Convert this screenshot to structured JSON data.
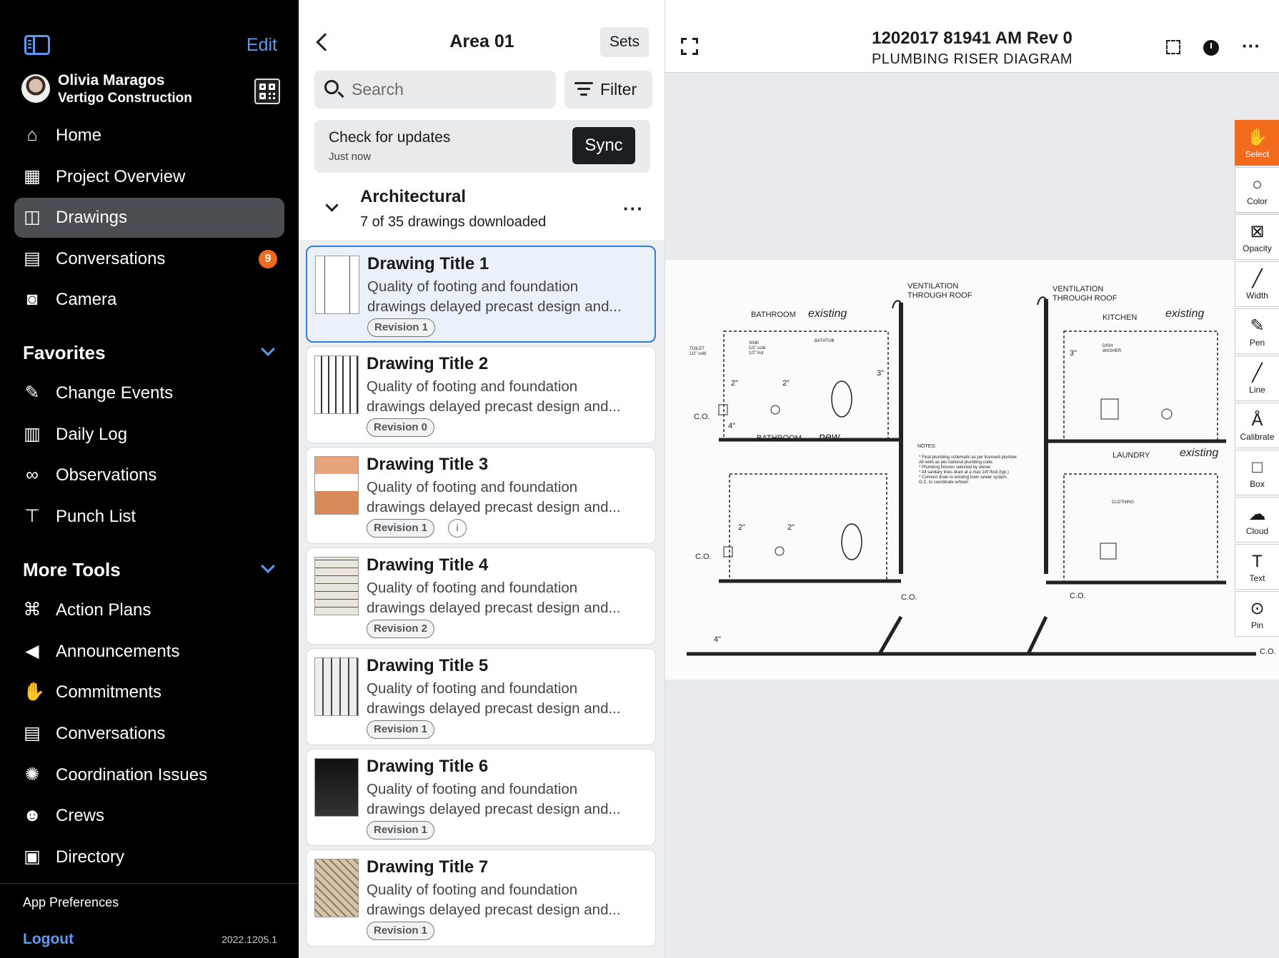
{
  "sidebar": {
    "edit_label": "Edit",
    "user": {
      "name": "Olivia Maragos",
      "company": "Vertigo Construction"
    },
    "nav": [
      {
        "label": "Home",
        "icon": "home-icon"
      },
      {
        "label": "Project Overview",
        "icon": "building-icon"
      },
      {
        "label": "Drawings",
        "icon": "drawings-icon",
        "active": true
      },
      {
        "label": "Conversations",
        "icon": "chat-icon",
        "badge": "9"
      },
      {
        "label": "Camera",
        "icon": "camera-icon"
      }
    ],
    "favorites_title": "Favorites",
    "favorites": [
      {
        "label": "Change Events",
        "icon": "change-events-icon"
      },
      {
        "label": "Daily Log",
        "icon": "clipboard-icon"
      },
      {
        "label": "Observations",
        "icon": "binoculars-icon"
      },
      {
        "label": "Punch List",
        "icon": "pin-icon"
      }
    ],
    "more_tools_title": "More Tools",
    "more_tools": [
      {
        "label": "Action Plans",
        "icon": "action-plans-icon"
      },
      {
        "label": "Announcements",
        "icon": "megaphone-icon"
      },
      {
        "label": "Commitments",
        "icon": "handshake-icon"
      },
      {
        "label": "Conversations",
        "icon": "chat-icon"
      },
      {
        "label": "Coordination Issues",
        "icon": "coordination-icon"
      },
      {
        "label": "Crews",
        "icon": "crews-icon"
      },
      {
        "label": "Directory",
        "icon": "directory-icon"
      }
    ],
    "app_preferences": "App Preferences",
    "logout": "Logout",
    "version": "2022.1205.1"
  },
  "list_panel": {
    "title": "Area 01",
    "sets_label": "Sets",
    "search_placeholder": "Search",
    "filter_label": "Filter",
    "updates": {
      "title": "Check for updates",
      "subtitle": "Just now",
      "sync_label": "Sync"
    },
    "group": {
      "title": "Architectural",
      "subtitle": "7 of 35 drawings downloaded"
    },
    "drawings": [
      {
        "title": "Drawing Title 1",
        "line1": "Quality of footing and foundation",
        "line2": "drawings delayed precast design and...",
        "revision": "Revision 1",
        "selected": true
      },
      {
        "title": "Drawing Title 2",
        "line1": "Quality of footing and foundation",
        "line2": "drawings delayed precast design and...",
        "revision": "Revision 0"
      },
      {
        "title": "Drawing Title 3",
        "line1": "Quality of footing and foundation",
        "line2": "drawings delayed precast design and...",
        "revision": "Revision 1",
        "info": true
      },
      {
        "title": "Drawing Title 4",
        "line1": "Quality of footing and foundation",
        "line2": "drawings delayed precast design and...",
        "revision": "Revision 2"
      },
      {
        "title": "Drawing Title 5",
        "line1": "Quality of footing and foundation",
        "line2": "drawings delayed precast design and...",
        "revision": "Revision 1"
      },
      {
        "title": "Drawing Title 6",
        "line1": "Quality of footing and foundation",
        "line2": "drawings delayed precast design and...",
        "revision": "Revision 1"
      },
      {
        "title": "Drawing Title 7",
        "line1": "Quality of footing and foundation",
        "line2": "drawings delayed precast design and...",
        "revision": "Revision 1"
      }
    ]
  },
  "viewer": {
    "title": "1202017 81941 AM Rev 0",
    "subtitle": "PLUMBING RISER DIAGRAM",
    "tools": [
      {
        "label": "Select",
        "icon": "hand-icon",
        "active": true
      },
      {
        "label": "Color",
        "icon": "color-icon"
      },
      {
        "label": "Opacity",
        "icon": "opacity-icon"
      },
      {
        "label": "Width",
        "icon": "width-icon"
      },
      {
        "label": "Pen",
        "icon": "pen-icon"
      },
      {
        "label": "Line",
        "icon": "line-icon"
      },
      {
        "label": "Calibrate",
        "icon": "calibrate-icon"
      },
      {
        "label": "Box",
        "icon": "box-icon"
      },
      {
        "label": "Cloud",
        "icon": "cloud-icon"
      },
      {
        "label": "Text",
        "icon": "text-icon"
      },
      {
        "label": "Pin",
        "icon": "location-pin-icon"
      }
    ],
    "drawing_text": {
      "vent1": "VENTILATION",
      "vent1b": "THROUGH ROOF",
      "vent2": "VENTILATION",
      "vent2b": "THROUGH ROOF",
      "bathroom1": "BATHROOM",
      "existing1": "existing",
      "kitchen": "KITCHEN",
      "existing2": "existing",
      "bathroom2": "BATHROOM",
      "new": "new",
      "laundry": "LAUNDRY",
      "existing3": "existing",
      "toilet": "TOILET",
      "toilet_spec": "1/2\" cold",
      "sink": "SINK",
      "sink_spec1": "1/2\" cold",
      "sink_spec2": "1/2\" hot",
      "bathtub": "BATHTUB",
      "dish": "DISH",
      "washer": "WASHER",
      "clothing": "CLOTHING",
      "co": "C.O.",
      "notes_title": "NOTES:",
      "notes": [
        "* Final plumbing schematic as per licensed plumber.",
        "  All work as per national plumbing code.",
        "* Plumbing fixtures selected by owner.",
        "* All sanitary lines drain at a max 1/4\"/foot (typ.)",
        "* Connect drain to existing town sewer system.",
        "  G.C. to coordinate w/town"
      ],
      "d2": "2\"",
      "d3": "3\"",
      "d4": "4\""
    }
  }
}
